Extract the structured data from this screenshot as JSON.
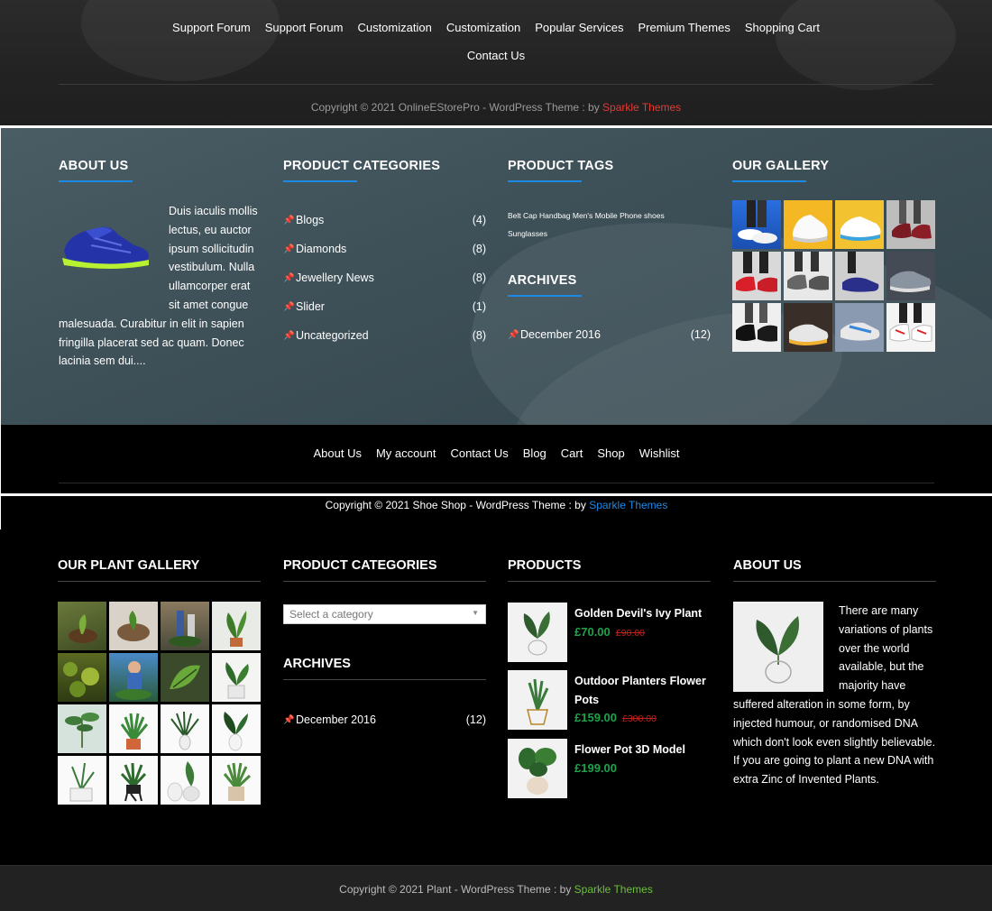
{
  "s1": {
    "menu_row1": [
      "Support Forum",
      "Support Forum",
      "Customization",
      "Customization",
      "Popular Services",
      "Premium Themes",
      "Shopping Cart"
    ],
    "menu_row2": [
      "Contact Us"
    ],
    "copyright": "Copyright © 2021 OnlineEStorePro - WordPress Theme : by ",
    "copyright_link": "Sparkle Themes",
    "link_color": "#e53935"
  },
  "s2": {
    "about_title": "ABOUT US",
    "about_text": "Duis iaculis mollis lectus, eu auctor ipsum sollicitudin vestibulum. Nulla ullamcorper erat sit amet congue malesuada. Curabitur in elit in sapien fringilla placerat sed ac quam. Donec lacinia sem dui....",
    "categories_title": "PRODUCT CATEGORIES",
    "categories": [
      {
        "name": "Blogs",
        "count": "(4)"
      },
      {
        "name": "Diamonds",
        "count": "(8)"
      },
      {
        "name": "Jewellery News",
        "count": "(8)"
      },
      {
        "name": "Slider",
        "count": "(1)"
      },
      {
        "name": "Uncategorized",
        "count": "(8)"
      }
    ],
    "tags_title": "PRODUCT TAGS",
    "tags": [
      "Belt",
      "Cap",
      "Handbag",
      "Men's",
      "Mobile Phone",
      "shoes",
      "Sunglasses"
    ],
    "archives_title": "ARCHIVES",
    "archives": [
      {
        "name": "December 2016",
        "count": "(12)"
      }
    ],
    "gallery_title": "OUR GALLERY",
    "accent": "#1e88e5"
  },
  "s2b": {
    "menu": [
      "About Us",
      "My account",
      "Contact Us",
      "Blog",
      "Cart",
      "Shop",
      "Wishlist"
    ],
    "copyright": "Copyright © 2021 Shoe Shop - WordPress Theme : by ",
    "copyright_link": "Sparkle Themes"
  },
  "s3": {
    "gallery_title": "OUR PLANT GALLERY",
    "categories_title": "PRODUCT CATEGORIES",
    "select_placeholder": "Select a category",
    "archives_title": "ARCHIVES",
    "archives": [
      {
        "name": "December 2016",
        "count": "(12)"
      }
    ],
    "products_title": "PRODUCTS",
    "products": [
      {
        "name": "Golden Devil's Ivy Plant",
        "price": "£70.00",
        "old": "£90.00"
      },
      {
        "name": "Outdoor Planters Flower Pots",
        "price": "£159.00",
        "old": "£300.00"
      },
      {
        "name": "Flower Pot 3D Model",
        "price": "£199.00",
        "old": ""
      }
    ],
    "about_title": "ABOUT US",
    "about_text": "There are many variations of plants over the world available, but the majority have suffered alteration in some form, by injected humour, or randomised DNA which don't look even slightly believable. If you are going to plant a new DNA with extra Zinc of Invented Plants.",
    "price_color": "#1ea34b"
  },
  "s4": {
    "copyright": "Copyright © 2021 Plant - WordPress Theme : by ",
    "copyright_link": "Sparkle Themes",
    "link_color": "#6bbf3a"
  }
}
